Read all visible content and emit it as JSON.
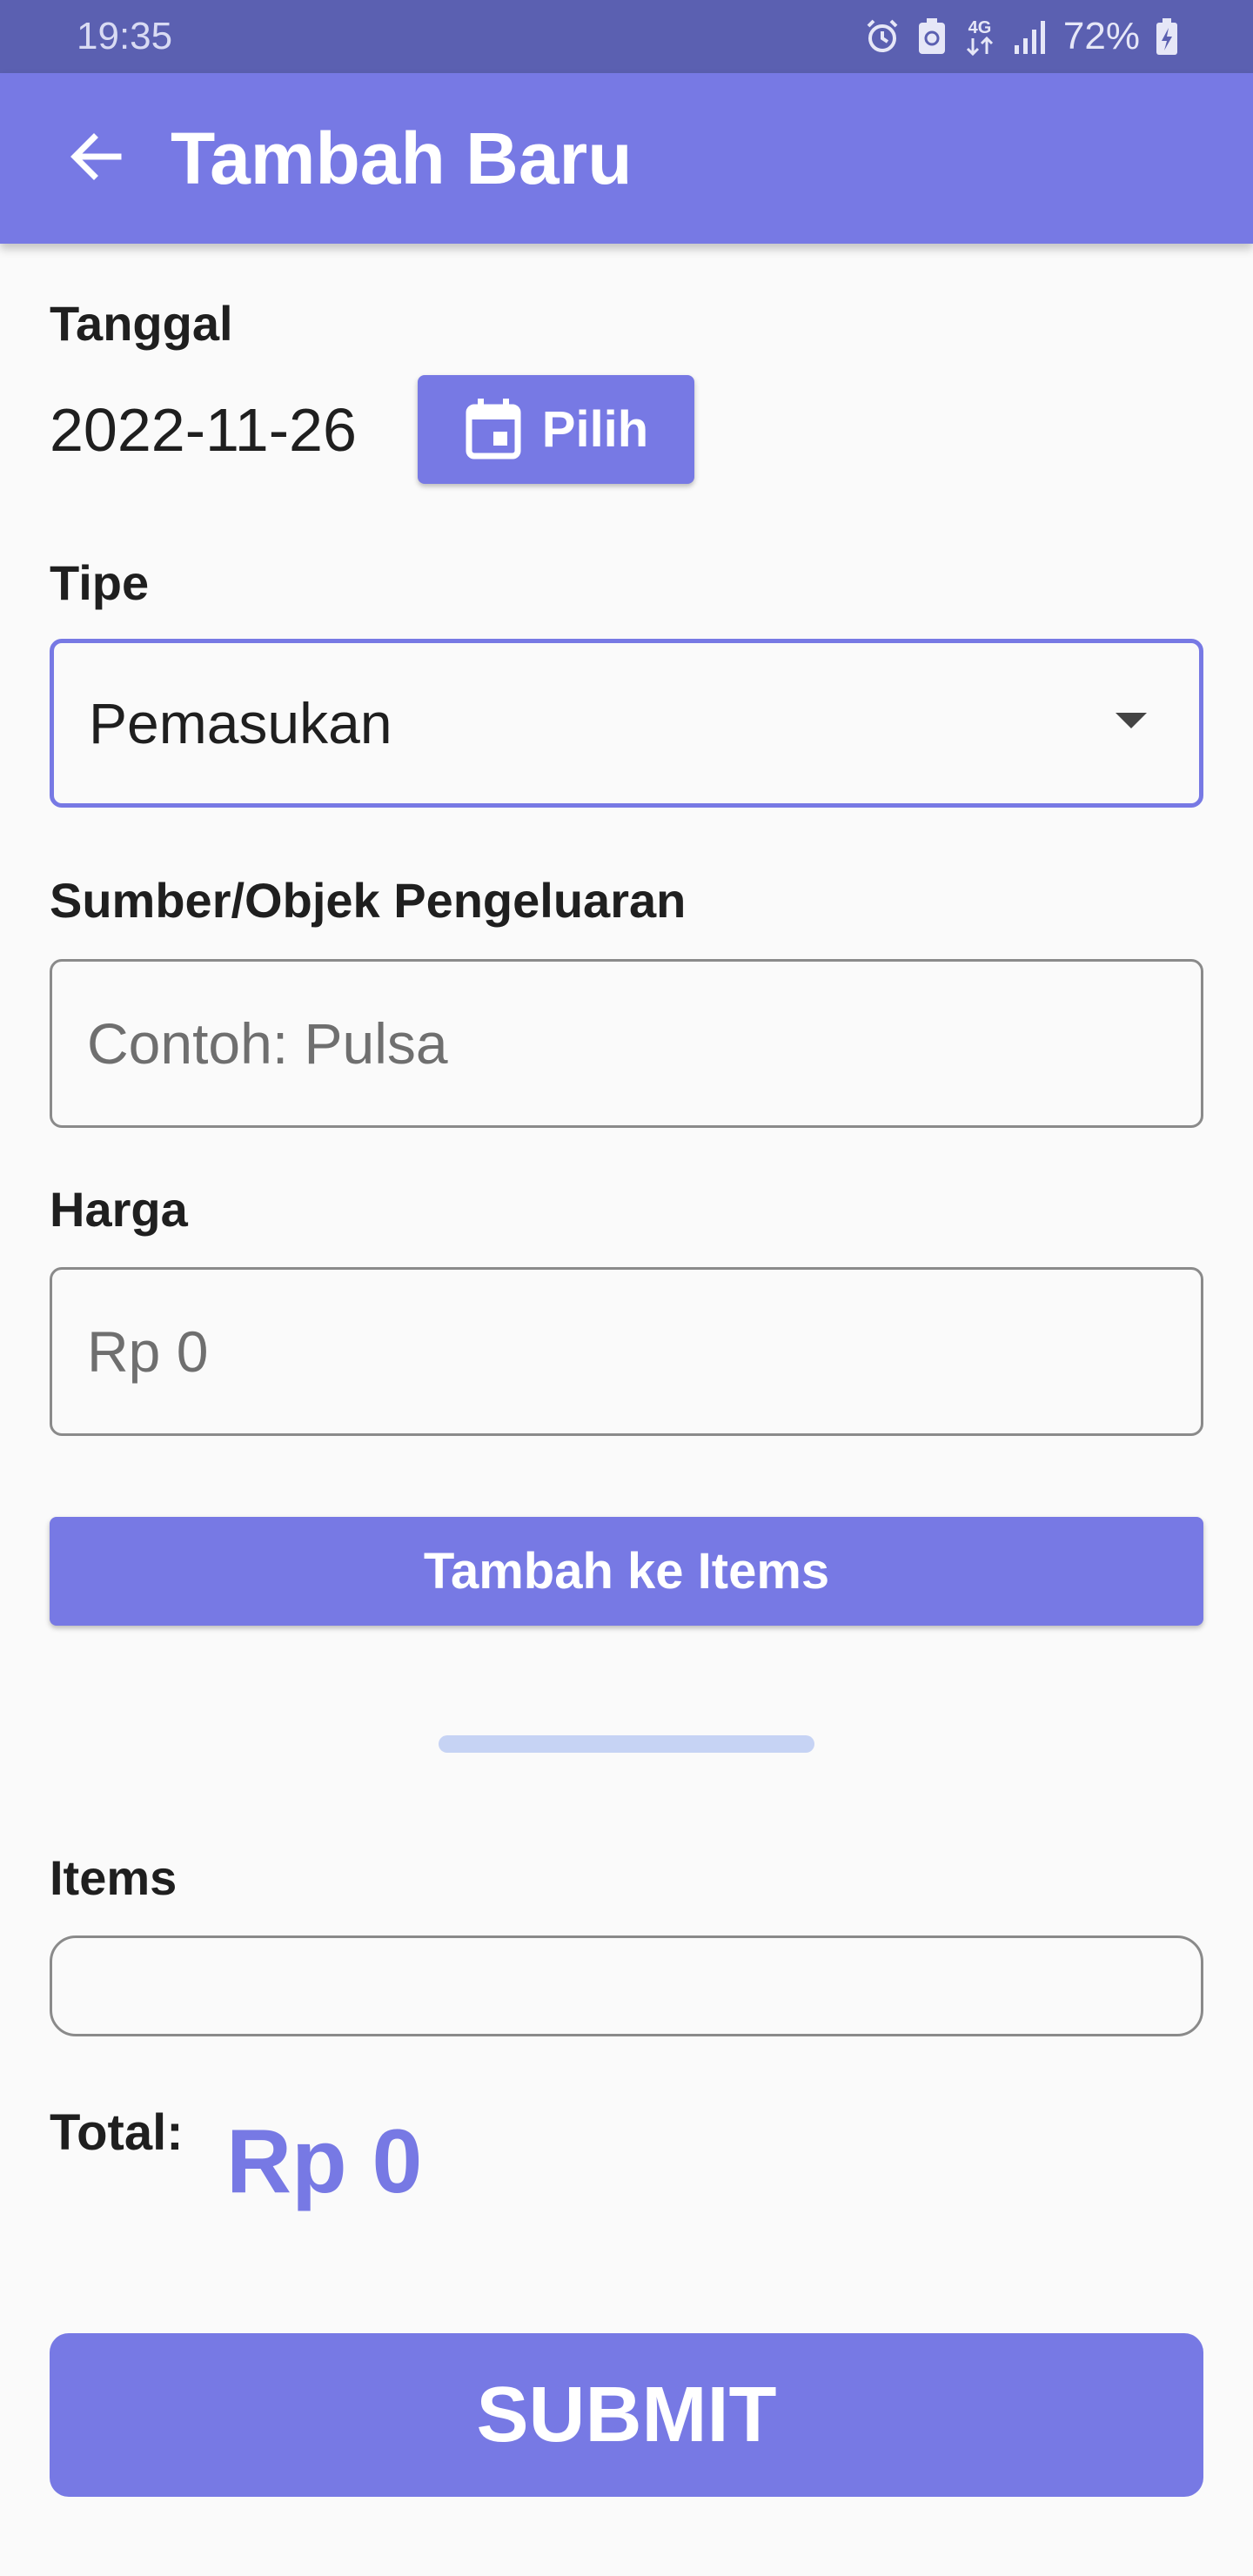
{
  "status_bar": {
    "time": "19:35",
    "network": "4G",
    "battery": "72%",
    "icons": [
      "alarm-icon",
      "recycle-battery-icon",
      "4g-icon",
      "signal-icon",
      "battery-charging-icon"
    ]
  },
  "app_bar": {
    "title": "Tambah Baru",
    "back_icon": "arrow-left-icon",
    "color": "#7779e4"
  },
  "form": {
    "date": {
      "label": "Tanggal",
      "value": "2022-11-26",
      "pick_button_label": "Pilih",
      "pick_icon": "calendar-icon"
    },
    "type": {
      "label": "Tipe",
      "selected": "Pemasukan"
    },
    "source": {
      "label": "Sumber/Objek Pengeluaran",
      "placeholder": "Contoh: Pulsa",
      "value": ""
    },
    "price": {
      "label": "Harga",
      "placeholder": "Rp 0",
      "value": ""
    },
    "add_button_label": "Tambah ke Items"
  },
  "items": {
    "label": "Items",
    "list": []
  },
  "total": {
    "label": "Total:",
    "value": "Rp 0"
  },
  "submit_label": "SUBMIT",
  "colors": {
    "status_bar": "#5b60b1",
    "primary": "#7779e4",
    "divider_pill": "#c6d3f4",
    "background": "#fafafa"
  }
}
